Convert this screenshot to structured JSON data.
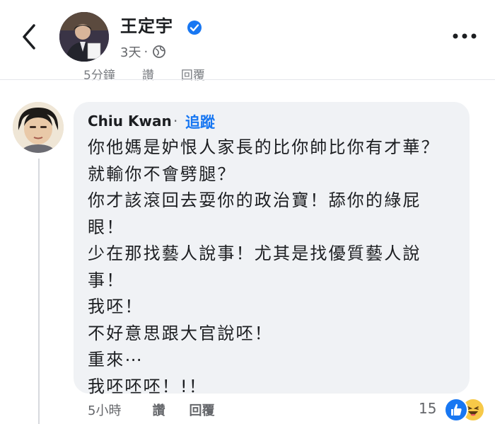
{
  "header": {
    "author_name": "王定宇",
    "post_age": "3天",
    "dot": "·",
    "icons": [
      "back-arrow-icon",
      "verified-badge-icon",
      "globe-icon",
      "more-options-icon"
    ]
  },
  "previous_comment": {
    "time": "5分鐘",
    "like": "讚",
    "reply": "回覆"
  },
  "comment": {
    "author": "Chiu Kwan",
    "dot": "·",
    "follow": "追蹤",
    "lines": [
      "你他媽是妒恨人家長的比你帥比你有才華？",
      "就輸你不會劈腿？",
      "你才該滾回去耍你的政治寶！舔你的綠屁",
      "眼！",
      "少在那找藝人說事！尤其是找優質藝人說",
      "事！",
      "我呸！",
      "不好意思跟大官說呸！",
      "重來⋯",
      "我呸呸呸！!！"
    ],
    "time": "5小時",
    "like": "讚",
    "reply": "回覆",
    "reaction_count": "15",
    "reactions": [
      "like-reaction-icon",
      "haha-reaction-icon"
    ]
  },
  "colors": {
    "accent": "#1877f2",
    "bubble": "#f0f2f5",
    "secondary_text": "#65676b"
  }
}
